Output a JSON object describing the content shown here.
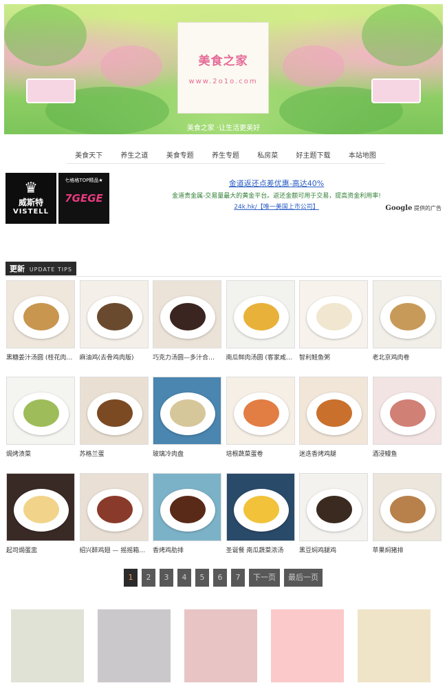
{
  "banner": {
    "title": "美食之家",
    "url": "www.2o1o.com",
    "caption": "美食之家 ·让生活更美好"
  },
  "nav": {
    "items": [
      "美食天下",
      "养生之道",
      "美食专题",
      "养生专题",
      "私房菜",
      "好主题下载",
      "本站地图"
    ]
  },
  "ads": {
    "ad1": {
      "lotus": "♛",
      "cn": "威斯特",
      "en": "VISTELL"
    },
    "ad2": {
      "top": "七格格TOP精品★",
      "big": "7GEGE"
    },
    "text_ad": {
      "headline": "金道返还点差优惠-高达40%",
      "line": "金道贵金属-交易量最大的黄金平台。返还金额可用于交易，提高资金利用率!",
      "link": "24k.hk/【唯一美国上市公司】"
    },
    "google": {
      "brand": "Google",
      "label": "提供的广告"
    }
  },
  "section": {
    "title": "更新",
    "subtitle": "UPDATE TIPS"
  },
  "recipes": [
    {
      "caption": "黑糖姜汁汤圆 (桂花肉…",
      "bg": "#efe7dc",
      "food": "#c8964f"
    },
    {
      "caption": "麻油鸡(去骨鸡肉版)",
      "bg": "#f4efe8",
      "food": "#6a4a2e"
    },
    {
      "caption": "巧克力汤圆—多汁合…",
      "bg": "#ebe3d8",
      "food": "#3b2520"
    },
    {
      "caption": "南瓜鲜肉汤圆 (客家咸…",
      "bg": "#f2f2ee",
      "food": "#e8b23a"
    },
    {
      "caption": "智利鲑鱼粥",
      "bg": "#f7f3ec",
      "food": "#f1e6cf"
    },
    {
      "caption": "老北京鸡肉卷",
      "bg": "#f1efe8",
      "food": "#c89a5a"
    },
    {
      "caption": "焗烤渍菜",
      "bg": "#f4f4f1",
      "food": "#9ebd5a"
    },
    {
      "caption": "苏格兰蛋",
      "bg": "#e9e0d3",
      "food": "#7b4a23"
    },
    {
      "caption": "玻璃冷肉盘",
      "bg": "#4a86b0",
      "food": "#d6c79a"
    },
    {
      "caption": "培根蔬菜蛋卷",
      "bg": "#f5efe6",
      "food": "#e27d44"
    },
    {
      "caption": "迷迭香烤鸡腿",
      "bg": "#f1e6d8",
      "food": "#c9702c"
    },
    {
      "caption": "酒浸鳗鱼",
      "bg": "#f3e4e4",
      "food": "#d18076"
    },
    {
      "caption": "起司焗蛋盅",
      "bg": "#3a2a26",
      "food": "#f1d48a"
    },
    {
      "caption": "绍兴醉鸡翅 — 摇摇箱…",
      "bg": "#e9dfd5",
      "food": "#8a3a2a"
    },
    {
      "caption": "香烤鸡肋排",
      "bg": "#7cb2c8",
      "food": "#5a2a18"
    },
    {
      "caption": "圣诞餐 南瓜蔬菜浓汤",
      "bg": "#2a4a6a",
      "food": "#f1c23a"
    },
    {
      "caption": "黑豆焖鸡腿鸡",
      "bg": "#f4f2ee",
      "food": "#3a2a20"
    },
    {
      "caption": "苹果焖猪排",
      "bg": "#ece6dc",
      "food": "#b8804a"
    }
  ],
  "pagination": {
    "pages": [
      "1",
      "2",
      "3",
      "4",
      "5",
      "6",
      "7"
    ],
    "current": "1",
    "next": "下一页",
    "last": "最后一页"
  },
  "swatches": [
    "#dfe2d5",
    "#cbc8cb",
    "#e8c4c4",
    "#fbc9c9",
    "#f0e4c8"
  ]
}
